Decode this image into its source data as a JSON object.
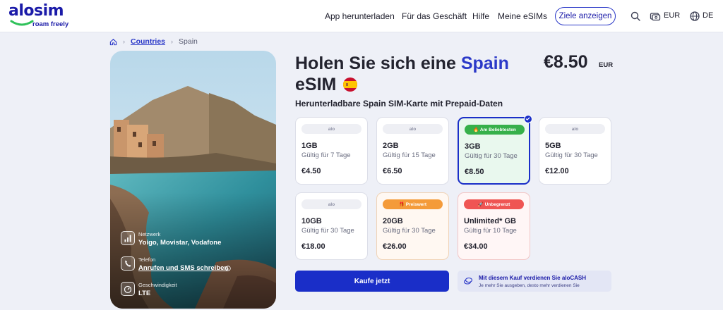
{
  "header": {
    "logo_word": "alosim",
    "logo_tagline": "roam freely",
    "nav": [
      "App herunterladen",
      "Für das Geschäft",
      "Hilfe",
      "Meine eSIMs"
    ],
    "cta_label": "Ziele anzeigen",
    "currency": "EUR",
    "language": "DE"
  },
  "breadcrumb": {
    "home_icon": "home-icon",
    "countries": "Countries",
    "current": "Spain"
  },
  "hero": {
    "network_label": "Netzwerk",
    "network_value": "Yoigo, Movistar, Vodafone",
    "phone_label": "Telefon",
    "phone_value": "Anrufen und SMS schreiben",
    "speed_label": "Geschwindigkeit",
    "speed_value": "LTE"
  },
  "product": {
    "title_prefix": "Holen Sie sich eine",
    "title_country": "Spain",
    "title_suffix": "eSIM",
    "price": "€8.50",
    "price_currency": "EUR",
    "subtitle": "Herunterladbare Spain SIM-Karte mit Prepaid-Daten"
  },
  "plans": [
    {
      "chip": "alo",
      "gb": "1GB",
      "days": "Gültig für 7 Tage",
      "price": "€4.50"
    },
    {
      "chip": "alo",
      "gb": "2GB",
      "days": "Gültig für 15 Tage",
      "price": "€6.50"
    },
    {
      "chip": "🔥 Am Beliebtesten",
      "gb": "3GB",
      "days": "Gültig für 30 Tage",
      "price": "€8.50"
    },
    {
      "chip": "alo",
      "gb": "5GB",
      "days": "Gültig für 30 Tage",
      "price": "€12.00"
    },
    {
      "chip": "alo",
      "gb": "10GB",
      "days": "Gültig für 30 Tage",
      "price": "€18.00"
    },
    {
      "chip": "🎁 Preiswert",
      "gb": "20GB",
      "days": "Gültig für 30 Tage",
      "price": "€26.00"
    },
    {
      "chip": "🚀 Unbegrenzt",
      "gb": "Unlimited* GB",
      "days": "Gültig für 10 Tage",
      "price": "€34.00"
    }
  ],
  "buy": {
    "label": "Kaufe jetzt",
    "cash_title": "Mit diesem Kauf verdienen Sie aloCASH",
    "cash_sub": "Je mehr Sie ausgeben, desto mehr verdienen Sie"
  },
  "colors": {
    "brand": "#1a2ec8",
    "popular": "#36b04a",
    "value": "#f49b3a",
    "unlimited": "#ef5553"
  }
}
